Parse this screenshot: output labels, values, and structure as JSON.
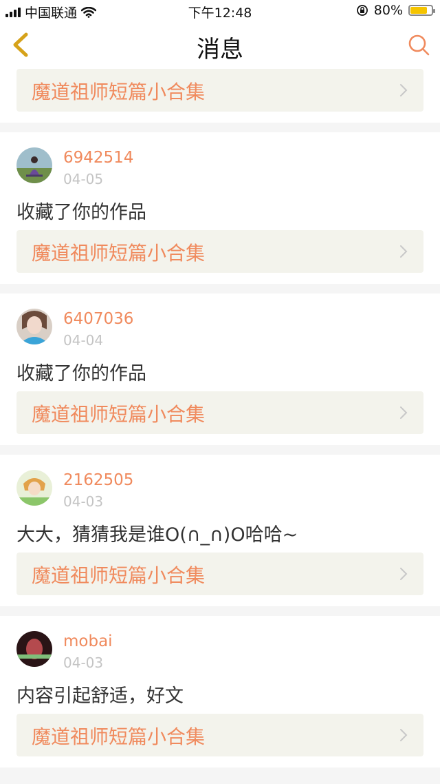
{
  "status_bar": {
    "carrier": "中国联通",
    "time": "下午12:48",
    "battery": "80%",
    "battery_level": 0.8
  },
  "nav": {
    "title": "消息",
    "back_icon": "back-chevron-icon",
    "search_icon": "search-icon"
  },
  "accent_color": "#f08a5d",
  "first_card": {
    "work_title": "魔道祖师短篇小合集"
  },
  "messages": [
    {
      "username": "6942514",
      "date": "04-05",
      "content": "收藏了你的作品",
      "work_title": "魔道祖师短篇小合集"
    },
    {
      "username": "6407036",
      "date": "04-04",
      "content": "收藏了你的作品",
      "work_title": "魔道祖师短篇小合集"
    },
    {
      "username": "2162505",
      "date": "04-03",
      "content": "大大，猜猜我是谁O(∩_∩)O哈哈~",
      "work_title": "魔道祖师短篇小合集"
    },
    {
      "username": "mobai",
      "date": "04-03",
      "content": "内容引起舒适，好文",
      "work_title": "魔道祖师短篇小合集"
    }
  ]
}
